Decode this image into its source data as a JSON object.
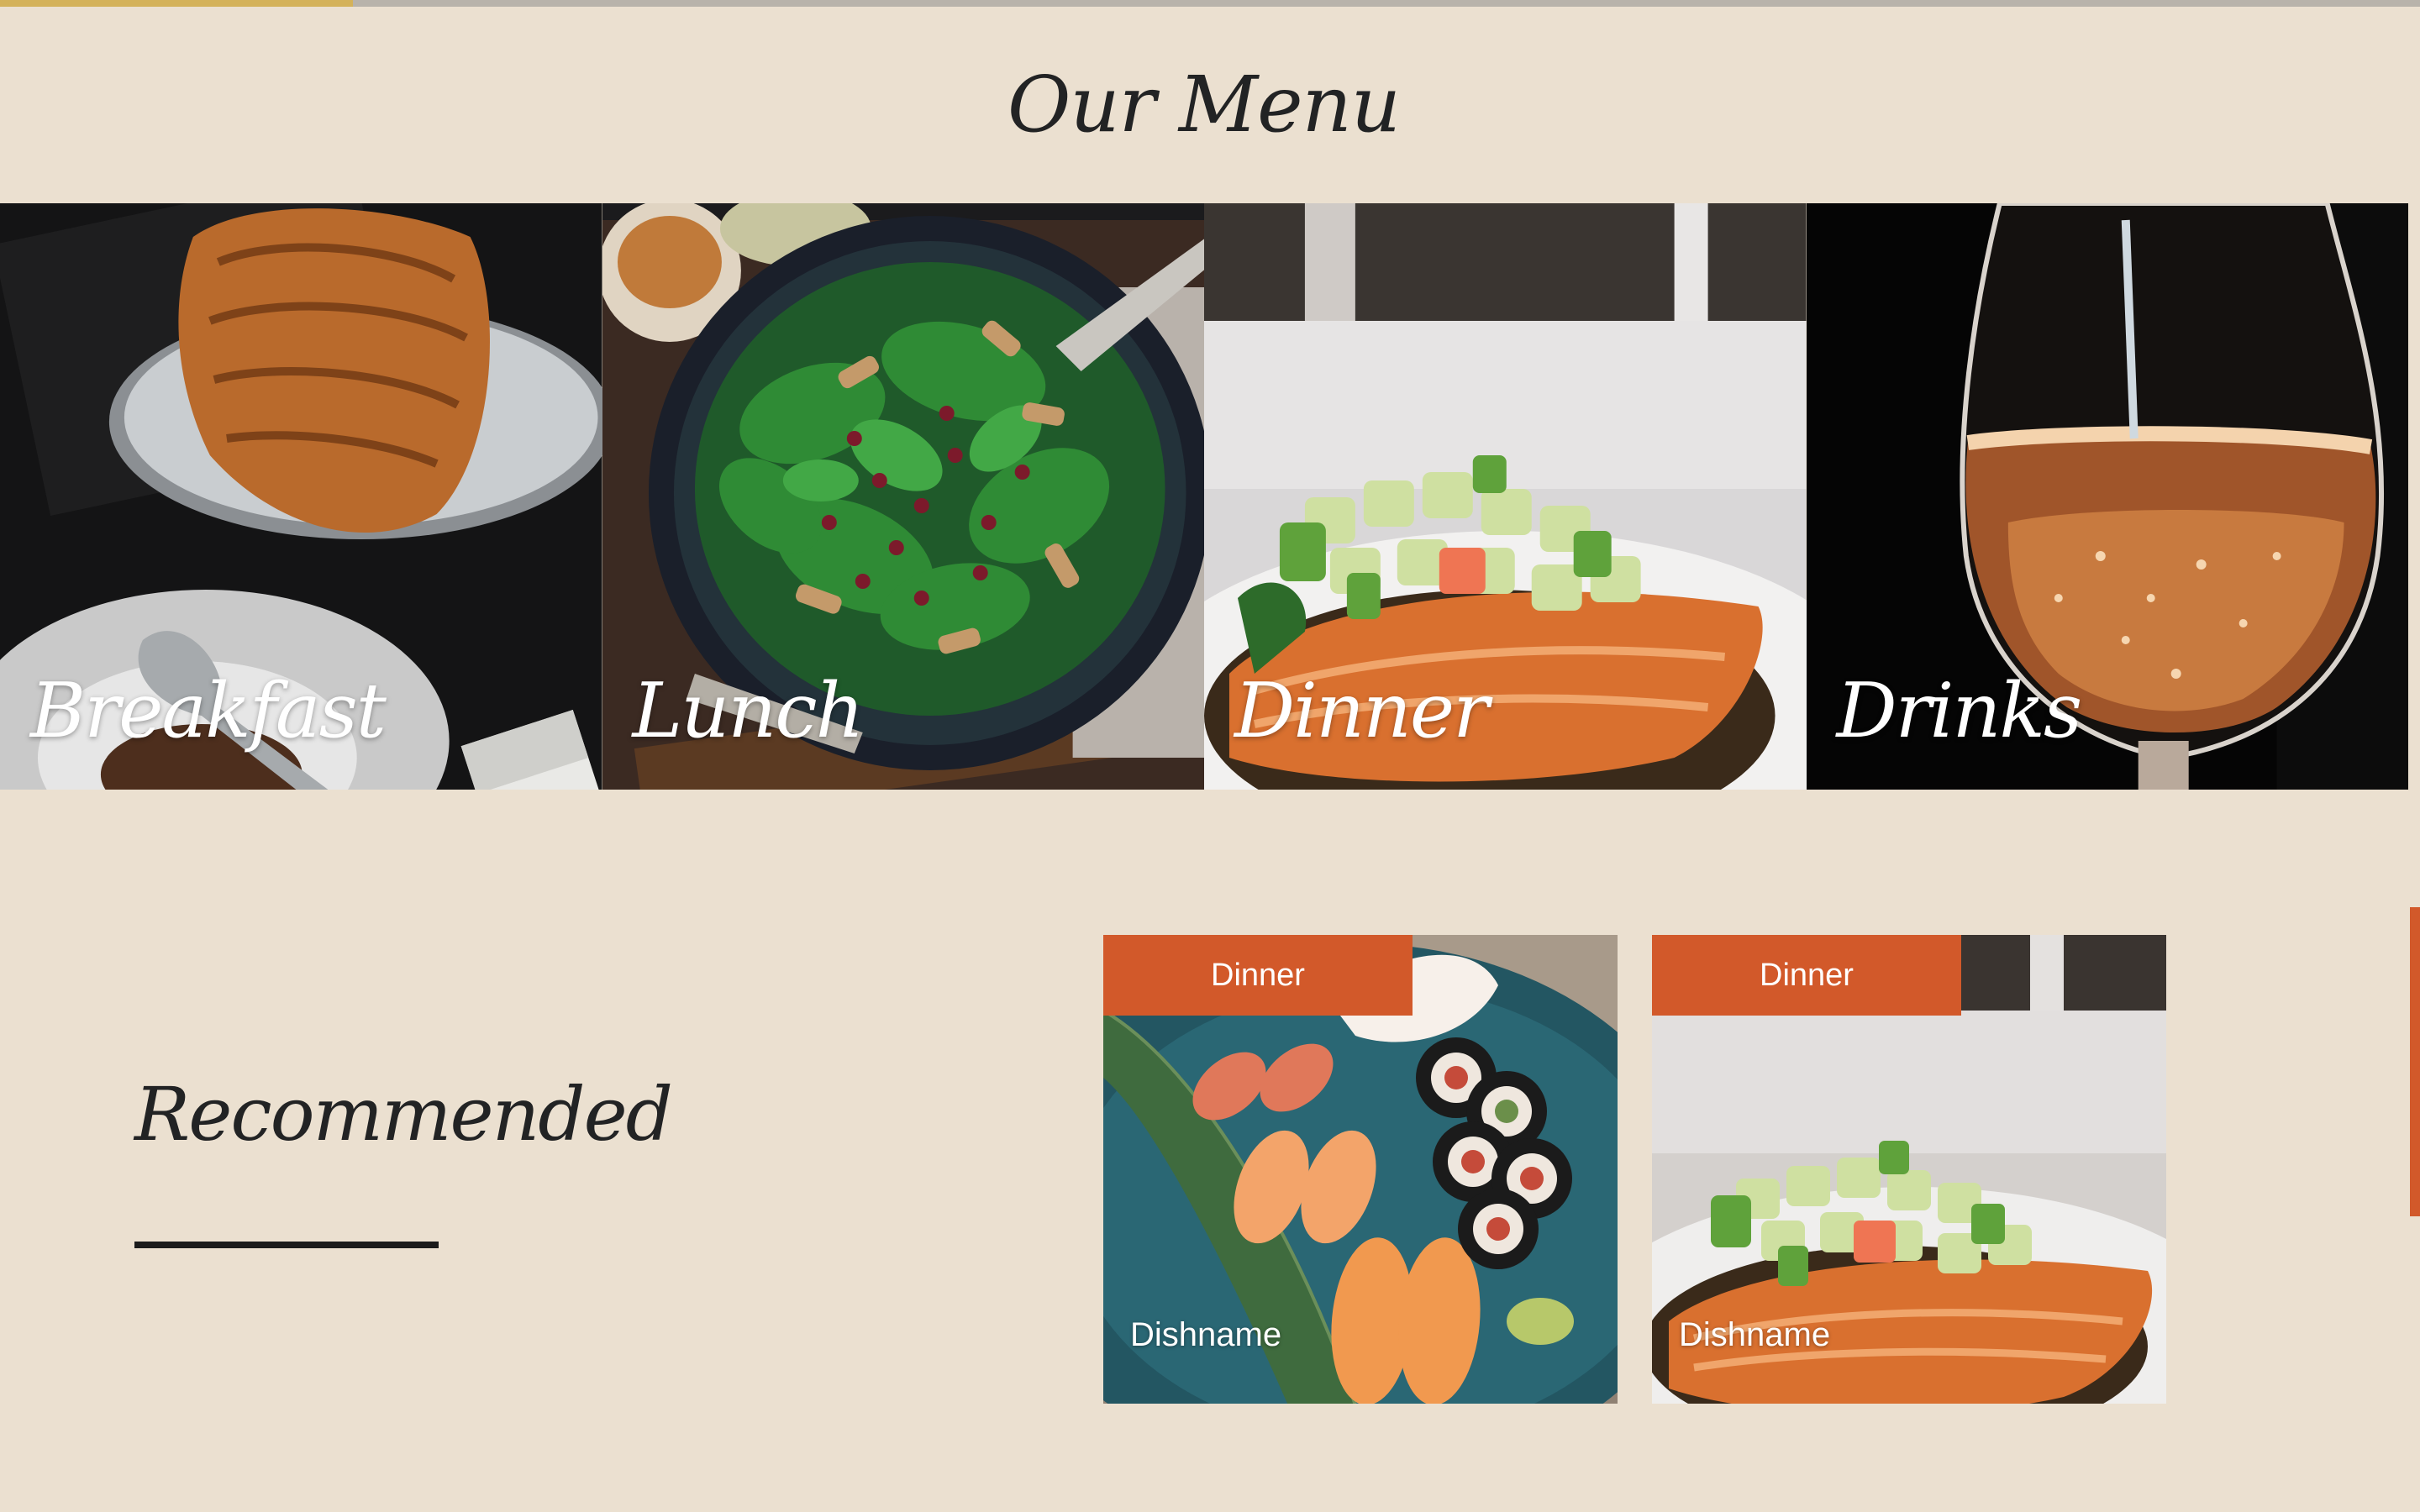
{
  "page": {
    "menu_title": "Our Menu",
    "recommended_title": "Recommended"
  },
  "menu_categories": [
    {
      "label": "Breakfast",
      "image": "croissant-and-coffee-photo"
    },
    {
      "label": "Lunch",
      "image": "spinach-salad-photo"
    },
    {
      "label": "Dinner",
      "image": "salmon-dish-photo"
    },
    {
      "label": "Drinks",
      "image": "wine-glass-photo"
    }
  ],
  "recommended": [
    {
      "category": "Dinner",
      "name": "Dishname",
      "image": "sushi-platter-photo"
    },
    {
      "category": "Dinner",
      "name": "Dishname",
      "image": "salmon-dish-photo"
    }
  ],
  "colors": {
    "background": "#ebe0d0",
    "accent": "#d2592a",
    "heading": "#222324",
    "label": "#ffffff"
  }
}
